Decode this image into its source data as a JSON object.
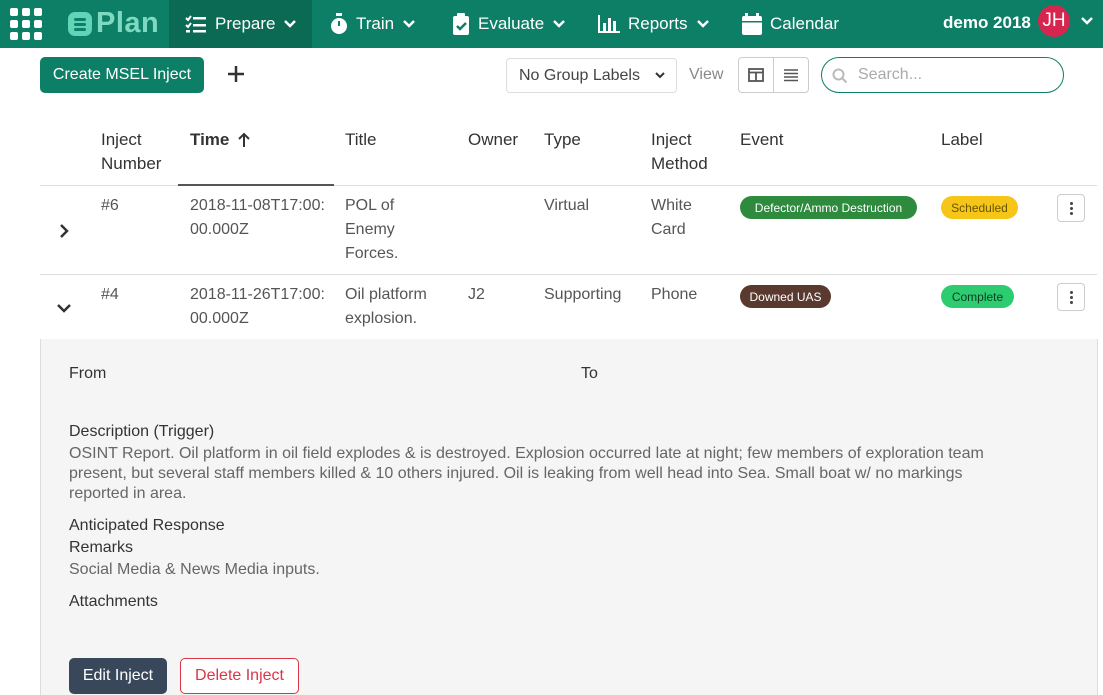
{
  "nav": {
    "brand": "Plan",
    "items": [
      {
        "label": "Prepare",
        "icon": "list-check-icon"
      },
      {
        "label": "Train",
        "icon": "stopwatch-icon"
      },
      {
        "label": "Evaluate",
        "icon": "clipboard-check-icon"
      },
      {
        "label": "Reports",
        "icon": "bar-chart-icon"
      },
      {
        "label": "Calendar",
        "icon": "calendar-icon"
      }
    ],
    "user": {
      "name": "demo 2018",
      "initials": "JH"
    }
  },
  "toolbar": {
    "create_label": "Create MSEL Inject",
    "group_select": "No Group Labels",
    "view_label": "View",
    "search_placeholder": "Search..."
  },
  "table": {
    "headers": {
      "inject_number": "Inject Number",
      "time": "Time",
      "title": "Title",
      "owner": "Owner",
      "type": "Type",
      "inject_method": "Inject Method",
      "event": "Event",
      "label": "Label"
    },
    "rows": [
      {
        "number": "#6",
        "time": "2018-11-08T17:00:00.000Z",
        "title": "POL of Enemy Forces.",
        "owner": "",
        "type": "Virtual",
        "method": "White Card",
        "event": "Defector/Ammo Destruction",
        "label": "Scheduled",
        "expanded": false
      },
      {
        "number": "#4",
        "time": "2018-11-26T17:00:00.000Z",
        "title": "Oil platform explosion.",
        "owner": "J2",
        "type": "Supporting",
        "method": "Phone",
        "event": "Downed UAS",
        "label": "Complete",
        "expanded": true
      }
    ]
  },
  "detail": {
    "from_label": "From",
    "to_label": "To",
    "description_label": "Description (Trigger)",
    "description_lines": [
      "OSINT Report. Oil platform in oil field explodes & is destroyed. Explosion occurred late at night; few members of exploration team",
      "present, but several staff members killed & 10 others injured. Oil is leaking from well head into Sea. Small boat w/ no markings",
      "reported in area."
    ],
    "anticipated_label": "Anticipated Response",
    "remarks_label": "Remarks",
    "remarks_text": "Social Media & News Media inputs.",
    "attachments_label": "Attachments",
    "edit_label": "Edit Inject",
    "delete_label": "Delete Inject"
  },
  "colors": {
    "nav": "#0d7f66",
    "nav_active": "#0a6a54",
    "event_green": "#2e8b3e",
    "event_brown": "#5a3a2e",
    "label_scheduled": "#f5c518",
    "label_complete": "#2ecc71",
    "avatar": "#d6254e"
  }
}
